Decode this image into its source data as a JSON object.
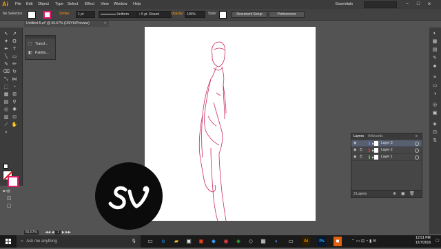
{
  "app": {
    "logo": "Ai",
    "essentials": "Essentials"
  },
  "menu": [
    "File",
    "Edit",
    "Object",
    "Type",
    "Select",
    "Effect",
    "View",
    "Window",
    "Help"
  ],
  "control": {
    "selection": "No Selection",
    "stroke_label": "Stroke",
    "stroke_value": "1 pt",
    "profile": "Uniform",
    "brush": "5 pt. Round",
    "opacity_label": "Opacity:",
    "opacity_value": "100%",
    "style_label": "Style:",
    "document_setup": "Document Setup",
    "preferences": "Preferences"
  },
  "document_tab": "Untitled-5.ai* @ 66.67% (CMYK/Preview)",
  "transform_panel": {
    "items": [
      "Transf...",
      "Pathfin..."
    ]
  },
  "layers_panel": {
    "tabs": [
      "Layers",
      "Artboards"
    ],
    "layers": [
      {
        "name": "Layer 3",
        "color": "#4f7bff",
        "selected": true
      },
      {
        "name": "Layer 2",
        "color": "#e03030",
        "selected": false
      },
      {
        "name": "Layer 1",
        "color": "#50c040",
        "selected": false
      }
    ],
    "footer": "3 Layers"
  },
  "status": {
    "zoom": "66.67%",
    "page": "1"
  },
  "watermark": "sv",
  "taskbar": {
    "search_placeholder": "Ask me anything",
    "time": "12:51 PM",
    "date": "12/7/2016"
  },
  "colors": {
    "accent": "#ff9a00",
    "stroke": "#e11e6e",
    "art_line": "#c8285f"
  }
}
